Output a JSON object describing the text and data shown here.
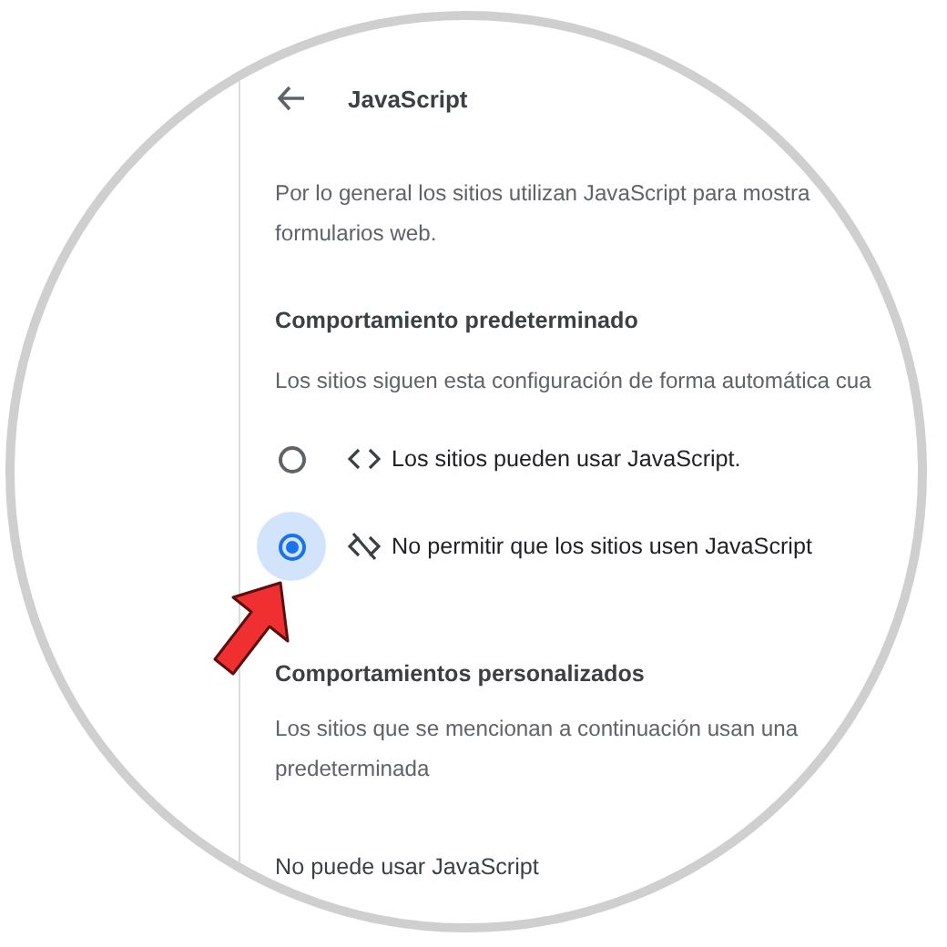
{
  "header": {
    "title": "JavaScript"
  },
  "intro": "Por lo general los sitios utilizan JavaScript para mostra\nformularios web.",
  "default_behavior": {
    "heading": "Comportamiento predeterminado",
    "description": "Los sitios siguen esta configuración de forma automática cua",
    "options": [
      {
        "kind": "allow",
        "label": "Los sitios pueden usar JavaScript.",
        "selected": false
      },
      {
        "kind": "block",
        "label": "No permitir que los sitios usen JavaScript",
        "selected": true
      }
    ]
  },
  "custom_behaviors": {
    "heading": "Comportamientos personalizados",
    "description": "Los sitios que se mencionan a continuación usan una\npredeterminada"
  },
  "blocked_list": {
    "heading": "No puede usar JavaScript"
  }
}
